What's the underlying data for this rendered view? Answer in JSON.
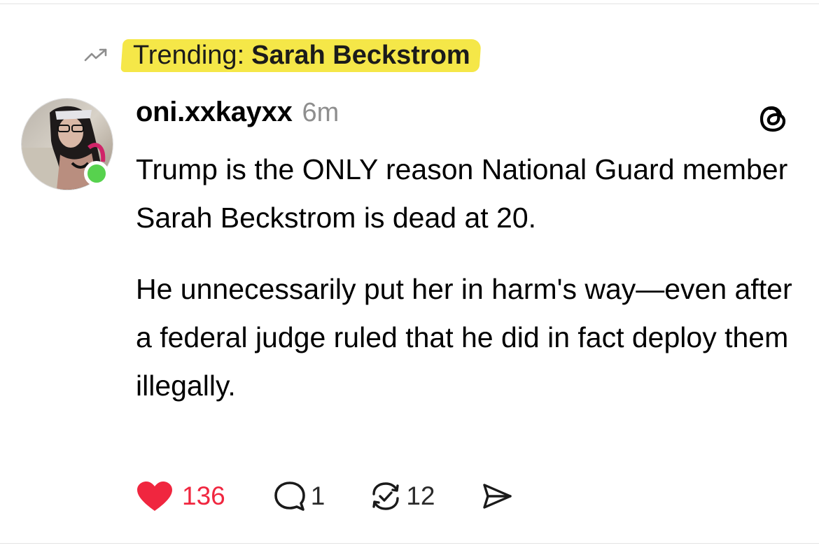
{
  "trending": {
    "prefix": "Trending:",
    "topic": "Sarah Beckstrom",
    "icon": "trending-arrow-icon",
    "highlight_color": "#f5e748"
  },
  "post": {
    "author": {
      "username": "oni.xxkayxx",
      "avatar_icon": "avatar",
      "online_status_color": "#57d24e"
    },
    "timestamp": "6m",
    "app_logo_icon": "threads-logo-icon",
    "paragraphs": [
      "Trump is the ONLY reason National Guard member Sarah Beckstrom is dead at 20.",
      "He unnecessarily put her in harm's way—even after a federal judge ruled that he did in fact deploy them illegally."
    ],
    "actions": {
      "likes": "136",
      "like_color": "#f0263f",
      "replies": "1",
      "reposts": "12",
      "share_icon": "send-icon"
    }
  }
}
